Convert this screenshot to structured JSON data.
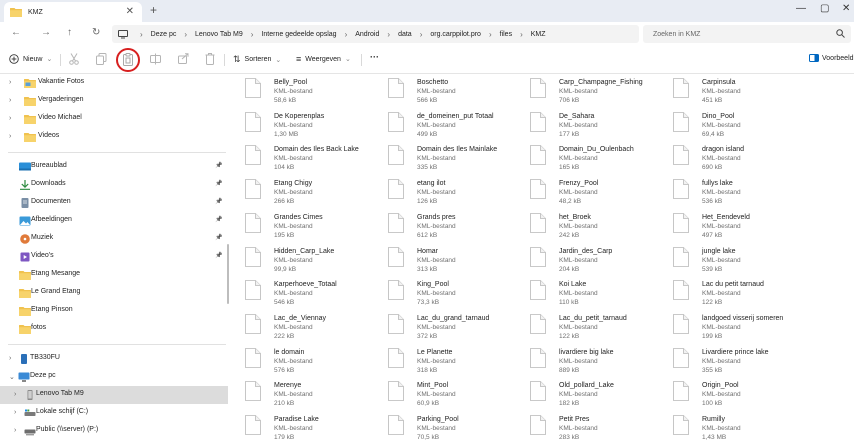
{
  "tab": {
    "title": "KMZ"
  },
  "breadcrumb": [
    "Deze pc",
    "Lenovo Tab M9",
    "Interne gedeelde opslag",
    "Android",
    "data",
    "org.carppilot.pro",
    "files",
    "KMZ"
  ],
  "search": {
    "placeholder": "Zoeken in KMZ"
  },
  "commands": {
    "new": "Nieuw",
    "sort": "Sorteren",
    "view": "Weergeven",
    "more": "···",
    "preview": "Voorbeeld"
  },
  "colors": {
    "accent": "#0067c0",
    "folder": "#f0c24f",
    "highlight": "#d71f1f"
  },
  "sidebar": {
    "top_folders": [
      "Vakantie Fotos",
      "Vergaderingen",
      "Video Michael",
      "Videos"
    ],
    "quick_access": [
      {
        "label": "Bureaublad",
        "icon": "desktop-icon",
        "pinned": true
      },
      {
        "label": "Downloads",
        "icon": "download-icon",
        "pinned": true
      },
      {
        "label": "Documenten",
        "icon": "documents-icon",
        "pinned": true
      },
      {
        "label": "Afbeeldingen",
        "icon": "pictures-icon",
        "pinned": true
      },
      {
        "label": "Muziek",
        "icon": "music-icon",
        "pinned": true
      },
      {
        "label": "Video's",
        "icon": "videos-icon",
        "pinned": true
      },
      {
        "label": "Etang Mesange",
        "icon": "folder-icon",
        "pinned": false
      },
      {
        "label": "Le Grand Etang",
        "icon": "folder-icon",
        "pinned": false
      },
      {
        "label": "Etang Pinson",
        "icon": "folder-icon",
        "pinned": false
      },
      {
        "label": "fotos",
        "icon": "folder-icon",
        "pinned": false
      }
    ],
    "drives": [
      "TB330FU",
      "Deze pc",
      "Lenovo Tab M9",
      "Lokale schijf (C:)",
      "Public (\\\\server) (P:)"
    ]
  },
  "files": [
    {
      "name": "Belly_Pool",
      "type": "KML-bestand",
      "size": "58,6 kB"
    },
    {
      "name": "Boschetto",
      "type": "KML-bestand",
      "size": "566 kB"
    },
    {
      "name": "Carp_Champagne_Fishing",
      "type": "KML-bestand",
      "size": "706 kB"
    },
    {
      "name": "Carpinsula",
      "type": "KML-bestand",
      "size": "451 kB"
    },
    {
      "name": "De Koperenplas",
      "type": "KML-bestand",
      "size": "1,30 MB"
    },
    {
      "name": "de_domeinen_put Totaal",
      "type": "KML-bestand",
      "size": "499 kB"
    },
    {
      "name": "De_Sahara",
      "type": "KML-bestand",
      "size": "177 kB"
    },
    {
      "name": "Dino_Pool",
      "type": "KML-bestand",
      "size": "69,4 kB"
    },
    {
      "name": "Domain des Iles Back Lake",
      "type": "KML-bestand",
      "size": "104 kB"
    },
    {
      "name": "Domain des Iles Mainlake",
      "type": "KML-bestand",
      "size": "335 kB"
    },
    {
      "name": "Domain_Du_Oulenbach",
      "type": "KML-bestand",
      "size": "165 kB"
    },
    {
      "name": "dragon island",
      "type": "KML-bestand",
      "size": "690 kB"
    },
    {
      "name": "Etang Chigy",
      "type": "KML-bestand",
      "size": "266 kB"
    },
    {
      "name": "etang ilot",
      "type": "KML-bestand",
      "size": "126 kB"
    },
    {
      "name": "Frenzy_Pool",
      "type": "KML-bestand",
      "size": "48,2 kB"
    },
    {
      "name": "fullys lake",
      "type": "KML-bestand",
      "size": "536 kB"
    },
    {
      "name": "Grandes Cimes",
      "type": "KML-bestand",
      "size": "195 kB"
    },
    {
      "name": "Grands pres",
      "type": "KML-bestand",
      "size": "612 kB"
    },
    {
      "name": "het_Broek",
      "type": "KML-bestand",
      "size": "242 kB"
    },
    {
      "name": "Het_Eendeveld",
      "type": "KML-bestand",
      "size": "497 kB"
    },
    {
      "name": "Hidden_Carp_Lake",
      "type": "KML-bestand",
      "size": "99,9 kB"
    },
    {
      "name": "Homar",
      "type": "KML-bestand",
      "size": "313 kB"
    },
    {
      "name": "Jardin_des_Carp",
      "type": "KML-bestand",
      "size": "204 kB"
    },
    {
      "name": "jungle lake",
      "type": "KML-bestand",
      "size": "539 kB"
    },
    {
      "name": "Karperhoeve_Totaal",
      "type": "KML-bestand",
      "size": "546 kB"
    },
    {
      "name": "King_Pool",
      "type": "KML-bestand",
      "size": "73,3 kB"
    },
    {
      "name": "Koi Lake",
      "type": "KML-bestand",
      "size": "110 kB"
    },
    {
      "name": "Lac du petit tarnaud",
      "type": "KML-bestand",
      "size": "122 kB"
    },
    {
      "name": "Lac_de_Viennay",
      "type": "KML-bestand",
      "size": "222 kB"
    },
    {
      "name": "Lac_du_grand_tarnaud",
      "type": "KML-bestand",
      "size": "372 kB"
    },
    {
      "name": "Lac_du_petit_tarnaud",
      "type": "KML-bestand",
      "size": "122 kB"
    },
    {
      "name": "landgoed visserij someren",
      "type": "KML-bestand",
      "size": "199 kB"
    },
    {
      "name": "le domain",
      "type": "KML-bestand",
      "size": "576 kB"
    },
    {
      "name": "Le Planette",
      "type": "KML-bestand",
      "size": "318 kB"
    },
    {
      "name": "livardiere big lake",
      "type": "KML-bestand",
      "size": "889 kB"
    },
    {
      "name": "Livardiere prince lake",
      "type": "KML-bestand",
      "size": "355 kB"
    },
    {
      "name": "Merenye",
      "type": "KML-bestand",
      "size": "210 kB"
    },
    {
      "name": "Mint_Pool",
      "type": "KML-bestand",
      "size": "60,9 kB"
    },
    {
      "name": "Old_pollard_Lake",
      "type": "KML-bestand",
      "size": "182 kB"
    },
    {
      "name": "Origin_Pool",
      "type": "KML-bestand",
      "size": "100 kB"
    },
    {
      "name": "Paradise Lake",
      "type": "KML-bestand",
      "size": "179 kB"
    },
    {
      "name": "Parking_Pool",
      "type": "KML-bestand",
      "size": "70,5 kB"
    },
    {
      "name": "Petit Pres",
      "type": "KML-bestand",
      "size": "283 kB"
    },
    {
      "name": "Rumilly",
      "type": "KML-bestand",
      "size": "1,43 MB"
    }
  ]
}
